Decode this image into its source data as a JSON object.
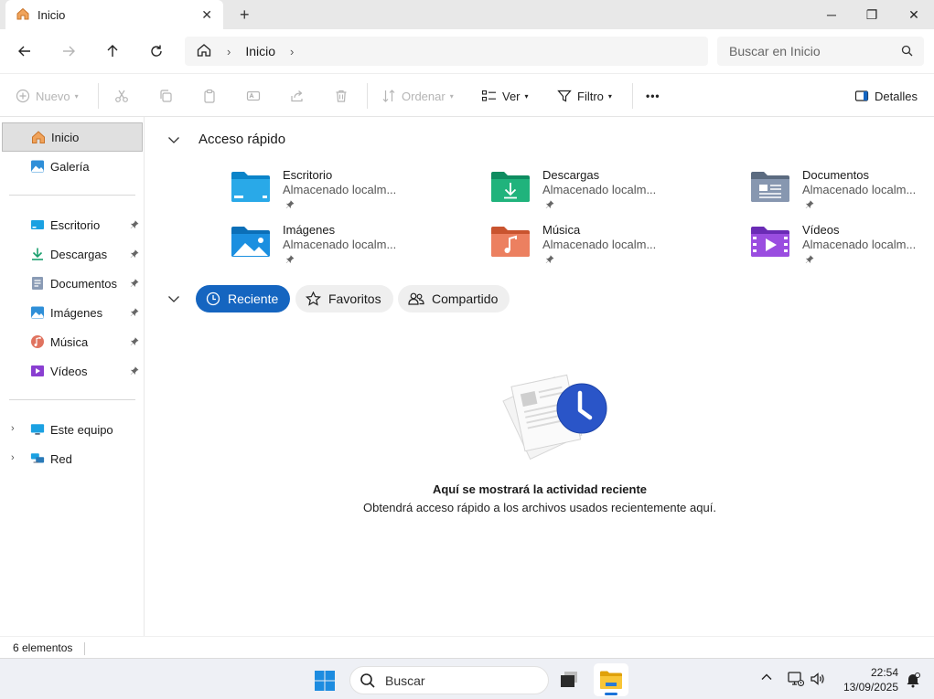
{
  "window": {
    "tab_title": "Inicio",
    "tab_close": "✕",
    "new_tab": "+",
    "minimize": "─",
    "maximize": "❐",
    "close": "✕"
  },
  "address": {
    "crumb": "Inicio",
    "separator": "›",
    "search_placeholder": "Buscar en Inicio"
  },
  "toolbar": {
    "new_label": "Nuevo",
    "sort_label": "Ordenar",
    "view_label": "Ver",
    "filter_label": "Filtro",
    "more": "•••",
    "details_label": "Detalles"
  },
  "sidebar": {
    "top": [
      {
        "label": "Inicio",
        "icon": "home-icon"
      },
      {
        "label": "Galería",
        "icon": "gallery-icon"
      }
    ],
    "pinned": [
      {
        "label": "Escritorio",
        "icon": "desktop-icon"
      },
      {
        "label": "Descargas",
        "icon": "download-icon"
      },
      {
        "label": "Documentos",
        "icon": "documents-icon"
      },
      {
        "label": "Imágenes",
        "icon": "pictures-icon"
      },
      {
        "label": "Música",
        "icon": "music-icon"
      },
      {
        "label": "Vídeos",
        "icon": "videos-icon"
      }
    ],
    "devices": [
      {
        "label": "Este equipo",
        "icon": "computer-icon"
      },
      {
        "label": "Red",
        "icon": "network-icon"
      }
    ]
  },
  "quick_access": {
    "title": "Acceso rápido",
    "items": [
      {
        "name": "Escritorio",
        "sub": "Almacenado localm..."
      },
      {
        "name": "Descargas",
        "sub": "Almacenado localm..."
      },
      {
        "name": "Documentos",
        "sub": "Almacenado localm..."
      },
      {
        "name": "Imágenes",
        "sub": "Almacenado localm..."
      },
      {
        "name": "Música",
        "sub": "Almacenado localm..."
      },
      {
        "name": "Vídeos",
        "sub": "Almacenado localm..."
      }
    ]
  },
  "filters": {
    "recent": "Reciente",
    "favorites": "Favoritos",
    "shared": "Compartido"
  },
  "empty": {
    "title": "Aquí se mostrará la actividad reciente",
    "subtitle": "Obtendrá acceso rápido a los archivos usados recientemente aquí."
  },
  "status": {
    "count": "6 elementos"
  },
  "taskbar": {
    "search_placeholder": "Buscar",
    "time": "22:54",
    "date": "13/09/2025"
  },
  "colors": {
    "accent": "#1565c0",
    "folder": "#f2b90c"
  }
}
